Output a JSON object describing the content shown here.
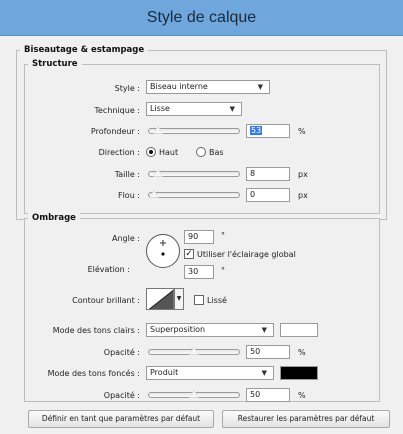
{
  "window": {
    "title": "Style de calque"
  },
  "bevel": {
    "section_title": "Biseautage & estampage",
    "structure_title": "Structure",
    "style_label": "Style :",
    "style_value": "Biseau interne",
    "technique_label": "Technique :",
    "technique_value": "Lisse",
    "depth_label": "Profondeur :",
    "depth_value": "53",
    "depth_unit": "%",
    "depth_fraction": 0.05,
    "direction_label": "Direction :",
    "direction_up": "Haut",
    "direction_down": "Bas",
    "direction_selected": "Haut",
    "size_label": "Taille :",
    "size_value": "8",
    "size_unit": "px",
    "size_fraction": 0.05,
    "blur_label": "Flou :",
    "blur_value": "0",
    "blur_unit": "px",
    "blur_fraction": 0.0
  },
  "shading": {
    "section_title": "Ombrage",
    "angle_label": "Angle :",
    "angle_value": "90",
    "angle_unit": "°",
    "global_light_label": "Utiliser l'éclairage global",
    "global_light_checked": true,
    "altitude_label": "Elévation :",
    "altitude_value": "30",
    "altitude_unit": "°",
    "gloss_contour_label": "Contour brillant :",
    "antialiased_label": "Lissé",
    "antialiased_checked": false,
    "highlight_mode_label": "Mode des tons clairs :",
    "highlight_mode_value": "Superposition",
    "highlight_color": "#ffffff",
    "highlight_opacity_label": "Opacité :",
    "highlight_opacity_value": "50",
    "highlight_opacity_unit": "%",
    "highlight_opacity_fraction": 0.5,
    "shadow_mode_label": "Mode des tons foncés :",
    "shadow_mode_value": "Produit",
    "shadow_color": "#000000",
    "shadow_opacity_label": "Opacité :",
    "shadow_opacity_value": "50",
    "shadow_opacity_unit": "%",
    "shadow_opacity_fraction": 0.5
  },
  "footer": {
    "make_default_label": "Définir en tant que paramètres par défaut",
    "reset_default_label": "Restaurer les paramètres par défaut"
  }
}
